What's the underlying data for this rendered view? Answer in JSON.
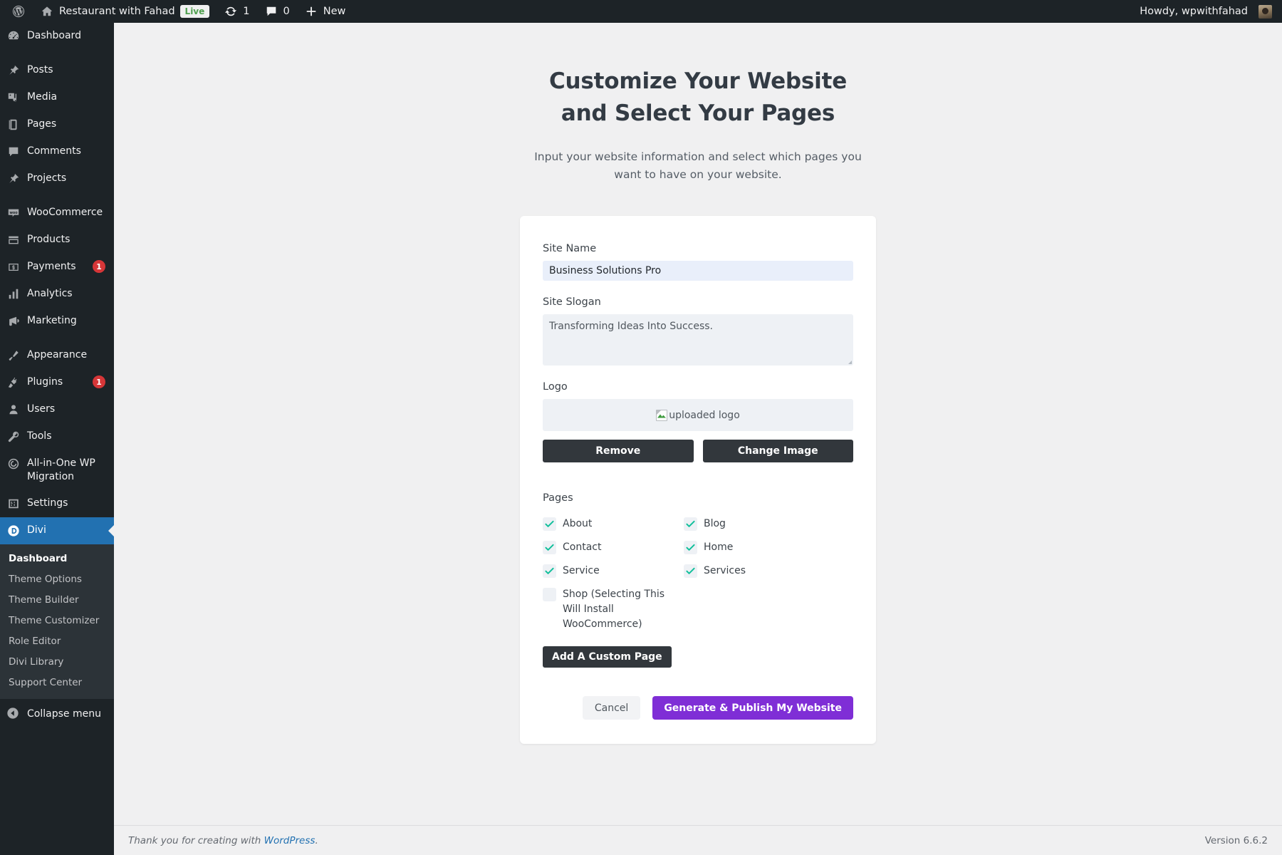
{
  "adminbar": {
    "wp_logo": "wordpress-logo-icon",
    "site_name": "Restaurant with Fahad",
    "live_badge": "Live",
    "updates_icon": "updates-icon",
    "updates_count": "1",
    "comments_icon": "comment-icon",
    "comments_count": "0",
    "new_icon": "plus-icon",
    "new_label": "New",
    "howdy": "Howdy, wpwithfahad"
  },
  "sidebar": {
    "items": [
      {
        "label": "Dashboard",
        "icon": "dashboard-icon",
        "sep_after": true
      },
      {
        "label": "Posts",
        "icon": "pin-icon"
      },
      {
        "label": "Media",
        "icon": "media-icon"
      },
      {
        "label": "Pages",
        "icon": "pages-icon"
      },
      {
        "label": "Comments",
        "icon": "comment-icon"
      },
      {
        "label": "Projects",
        "icon": "pin-icon",
        "sep_after": true
      },
      {
        "label": "WooCommerce",
        "icon": "woocommerce-icon"
      },
      {
        "label": "Products",
        "icon": "products-icon"
      },
      {
        "label": "Payments",
        "icon": "payments-icon",
        "badge": "1"
      },
      {
        "label": "Analytics",
        "icon": "analytics-icon"
      },
      {
        "label": "Marketing",
        "icon": "megaphone-icon",
        "sep_after": true
      },
      {
        "label": "Appearance",
        "icon": "appearance-icon"
      },
      {
        "label": "Plugins",
        "icon": "plugins-icon",
        "badge": "1"
      },
      {
        "label": "Users",
        "icon": "users-icon"
      },
      {
        "label": "Tools",
        "icon": "tools-icon"
      },
      {
        "label": "All-in-One WP Migration",
        "icon": "migration-icon"
      },
      {
        "label": "Settings",
        "icon": "settings-icon"
      },
      {
        "label": "Divi",
        "icon": "divi-icon",
        "current": true
      }
    ],
    "submenu": [
      {
        "label": "Dashboard",
        "current": true
      },
      {
        "label": "Theme Options"
      },
      {
        "label": "Theme Builder"
      },
      {
        "label": "Theme Customizer"
      },
      {
        "label": "Role Editor"
      },
      {
        "label": "Divi Library"
      },
      {
        "label": "Support Center"
      }
    ],
    "collapse_label": "Collapse menu",
    "collapse_icon": "collapse-arrow-icon"
  },
  "wizard": {
    "title": "Customize Your Website and Select Your Pages",
    "subtitle": "Input your website information and select which pages you want to have on your website.",
    "site_name_label": "Site Name",
    "site_name_value": "Business Solutions Pro",
    "site_slogan_label": "Site Slogan",
    "site_slogan_value": "Transforming Ideas Into Success.",
    "logo_label": "Logo",
    "logo_alt_text": "uploaded logo",
    "logo_icon": "broken-image-icon",
    "remove_label": "Remove",
    "change_image_label": "Change Image",
    "pages_label": "Pages",
    "pages": [
      {
        "label": "About",
        "checked": true
      },
      {
        "label": "Blog",
        "checked": true
      },
      {
        "label": "Contact",
        "checked": true
      },
      {
        "label": "Home",
        "checked": true
      },
      {
        "label": "Service",
        "checked": true
      },
      {
        "label": "Services",
        "checked": true
      },
      {
        "label": "Shop (Selecting This Will Install WooCommerce)",
        "checked": false
      }
    ],
    "add_custom_page_label": "Add A Custom Page",
    "cancel_label": "Cancel",
    "generate_label": "Generate & Publish My Website",
    "accent_color": "#7f2ed6",
    "check_color": "#0fbf9a"
  },
  "footer": {
    "thanks_prefix": "Thank you for creating with ",
    "wordpress_link": "WordPress",
    "thanks_suffix": ".",
    "version": "Version 6.6.2"
  }
}
